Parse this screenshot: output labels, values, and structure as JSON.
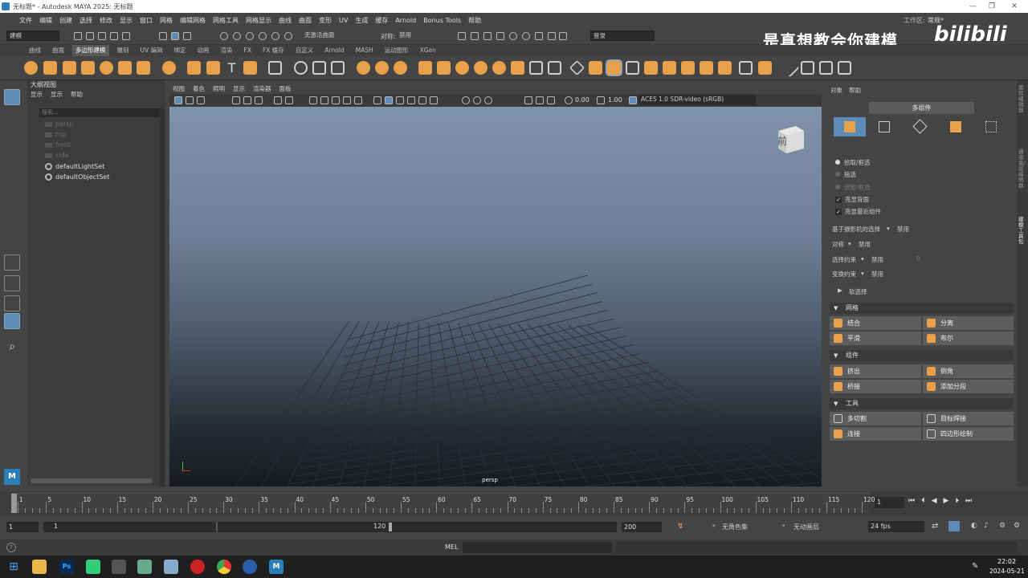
{
  "window": {
    "title": "无标题* - Autodesk MAYA 2025: 无标题"
  },
  "menu": [
    "文件",
    "编辑",
    "创建",
    "选择",
    "修改",
    "显示",
    "窗口",
    "网格",
    "编辑网格",
    "网格工具",
    "网格显示",
    "曲线",
    "曲面",
    "变形",
    "UV",
    "生成",
    "缓存",
    "Arnold",
    "Bonus Tools",
    "帮助"
  ],
  "workspace": {
    "label": "工作区:",
    "value": "常规*"
  },
  "status": {
    "mode": "建模",
    "live_surface": "无激活曲面",
    "symmetry_label": "对称:",
    "symmetry_value": "禁用",
    "login": "登录"
  },
  "shelf_tabs": [
    "曲线",
    "曲面",
    "多边形建模",
    "雕刻",
    "UV 编辑",
    "绑定",
    "动画",
    "渲染",
    "FX",
    "FX 缓存",
    "自定义",
    "Arnold",
    "MASH",
    "运动图形",
    "XGen"
  ],
  "shelf_active": "多边形建模",
  "outliner": {
    "title": "大纲视图",
    "menu": [
      "显示",
      "显示",
      "帮助"
    ],
    "search_placeholder": "搜索...",
    "items": [
      {
        "label": "persp",
        "dim": true
      },
      {
        "label": "top",
        "dim": true
      },
      {
        "label": "front",
        "dim": true
      },
      {
        "label": "side",
        "dim": true
      },
      {
        "label": "defaultLightSet",
        "dim": false
      },
      {
        "label": "defaultObjectSet",
        "dim": false
      }
    ]
  },
  "viewport": {
    "menu": [
      "视图",
      "着色",
      "照明",
      "显示",
      "渲染器",
      "面板"
    ],
    "exposure": "0.00",
    "gamma": "1.00",
    "colorspace": "ACES 1.0 SDR-video (sRGB)",
    "camera": "persp",
    "cube_face": "前"
  },
  "modeling_toolkit": {
    "menu": [
      "对象",
      "帮助"
    ],
    "title": "多组件",
    "select_options": [
      {
        "label": "拾取/框选",
        "on": true
      },
      {
        "label": "拖选",
        "on": false
      },
      {
        "label": "调整/框选",
        "on": false
      }
    ],
    "checks": [
      "亮显背面",
      "亮显最近组件"
    ],
    "camera_select": {
      "label": "基于摄影机的选择",
      "value": "禁用"
    },
    "symmetry": {
      "label": "对称",
      "value": "禁用"
    },
    "select_constraint": {
      "label": "选择约束",
      "value": "禁用",
      "num": "0"
    },
    "transform_constraint": {
      "label": "变换约束",
      "value": "禁用"
    },
    "soft_select": "软选择",
    "sections": [
      {
        "title": "网格",
        "buttons": [
          "结合",
          "分离",
          "平滑",
          "布尔"
        ]
      },
      {
        "title": "组件",
        "buttons": [
          "挤出",
          "倒角",
          "桥接",
          "添加分段"
        ]
      },
      {
        "title": "工具",
        "buttons": [
          "多切割",
          "目标焊接",
          "连接",
          "四边形绘制"
        ]
      }
    ],
    "side_tabs": [
      "属性编辑器",
      "通道盒/层编辑器",
      "建模工具包"
    ]
  },
  "timeline": {
    "ticks": [
      "1",
      "5",
      "10",
      "15",
      "20",
      "25",
      "30",
      "35",
      "40",
      "45",
      "50",
      "55",
      "60",
      "65",
      "70",
      "75",
      "80",
      "85",
      "90",
      "95",
      "100",
      "105",
      "110",
      "115",
      "120"
    ],
    "current_frame": "1",
    "range_start": "1",
    "range_inner_start": "1",
    "range_inner_end": "120",
    "range_end": "200",
    "char_set": "无角色集",
    "anim_layer": "无动画层",
    "fps": "24 fps"
  },
  "cmdline": {
    "label": "MEL"
  },
  "taskbar": {
    "time": "22:02",
    "date": "2024-05-21"
  },
  "watermark": {
    "text": "是真想教会你建模",
    "brand": "bilibili"
  },
  "colors": {
    "accent": "#5d8bb8",
    "orange": "#e8a04a"
  }
}
